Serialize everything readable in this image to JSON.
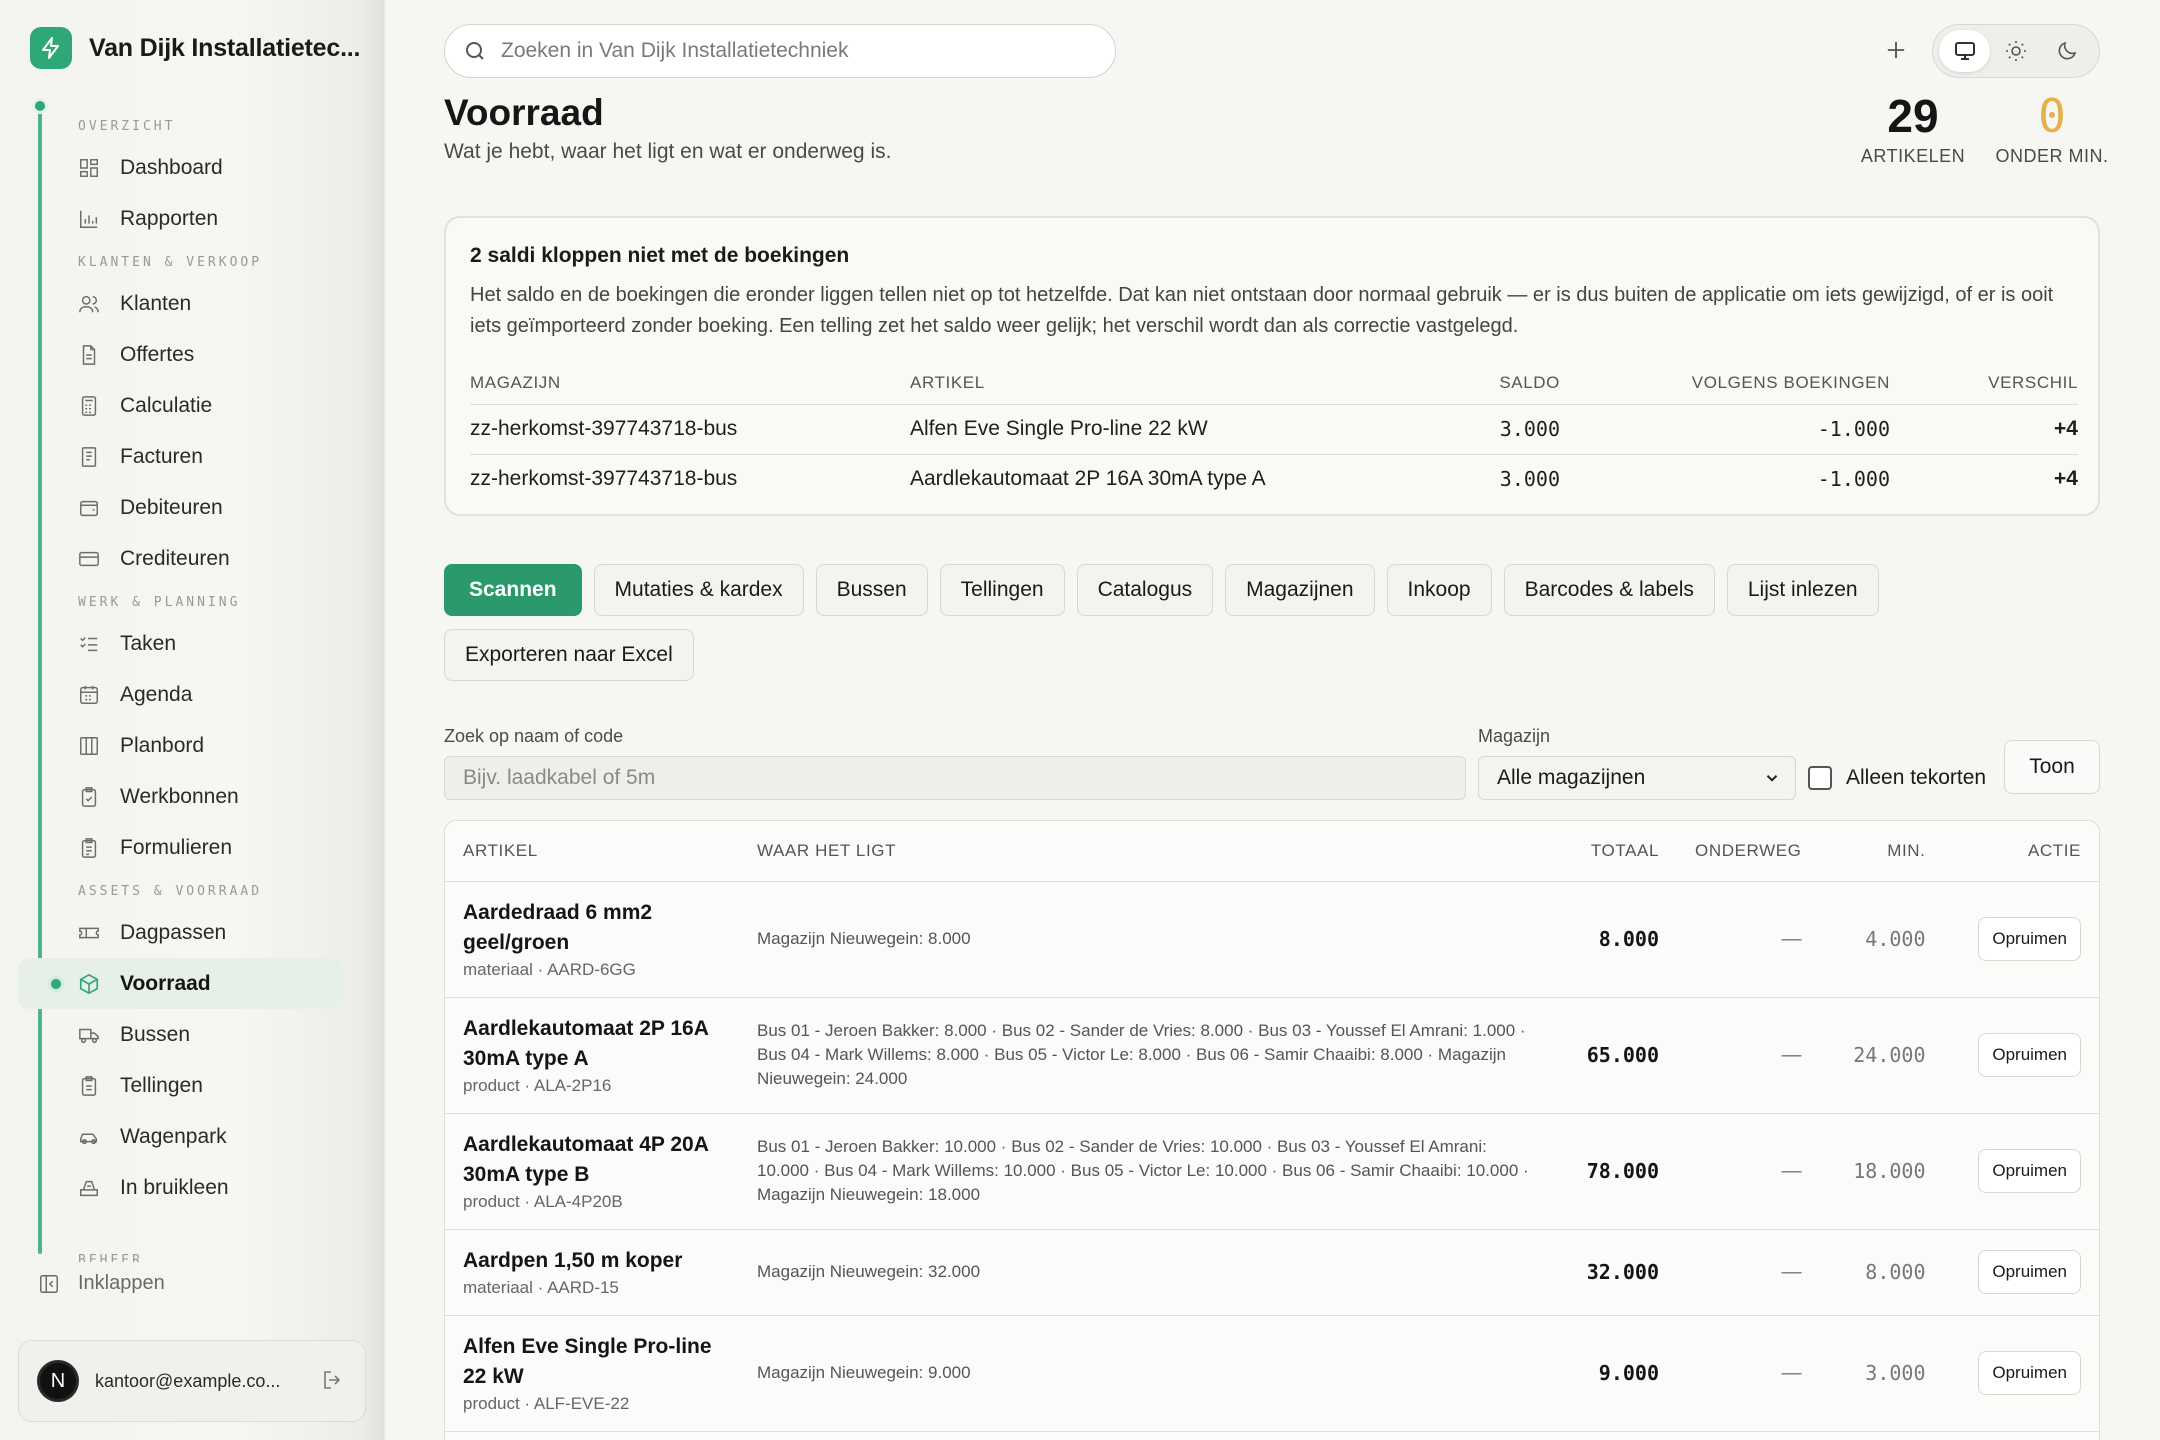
{
  "brand": {
    "name": "Van Dijk Installatietec..."
  },
  "nav": {
    "sections": [
      {
        "title": "OVERZICHT",
        "items": [
          {
            "label": "Dashboard",
            "icon": "dashboard-icon"
          },
          {
            "label": "Rapporten",
            "icon": "bar-chart-icon"
          }
        ]
      },
      {
        "title": "KLANTEN & VERKOOP",
        "items": [
          {
            "label": "Klanten",
            "icon": "users-icon"
          },
          {
            "label": "Offertes",
            "icon": "document-icon"
          },
          {
            "label": "Calculatie",
            "icon": "calculator-icon"
          },
          {
            "label": "Facturen",
            "icon": "invoice-icon"
          },
          {
            "label": "Debiteuren",
            "icon": "wallet-icon"
          },
          {
            "label": "Crediteuren",
            "icon": "card-icon"
          }
        ]
      },
      {
        "title": "WERK & PLANNING",
        "items": [
          {
            "label": "Taken",
            "icon": "list-icon"
          },
          {
            "label": "Agenda",
            "icon": "calendar-icon"
          },
          {
            "label": "Planbord",
            "icon": "board-icon"
          },
          {
            "label": "Werkbonnen",
            "icon": "clipboard-check-icon"
          },
          {
            "label": "Formulieren",
            "icon": "form-icon"
          }
        ]
      },
      {
        "title": "ASSETS & VOORRAAD",
        "items": [
          {
            "label": "Dagpassen",
            "icon": "ticket-icon"
          },
          {
            "label": "Voorraad",
            "icon": "box-icon",
            "active": true
          },
          {
            "label": "Bussen",
            "icon": "van-icon"
          },
          {
            "label": "Tellingen",
            "icon": "clipboard-icon"
          },
          {
            "label": "Wagenpark",
            "icon": "car-icon"
          },
          {
            "label": "In bruikleen",
            "icon": "tray-icon"
          }
        ]
      }
    ],
    "cut_section": "BEHEER",
    "collapse_label": "Inklappen"
  },
  "user": {
    "initial": "N",
    "email": "kantoor@example.co..."
  },
  "search": {
    "placeholder": "Zoeken in Van Dijk Installatietechniek"
  },
  "page": {
    "title": "Voorraad",
    "subtitle": "Wat je hebt, waar het ligt en wat er onderweg is."
  },
  "stats": {
    "articles": {
      "value": "29",
      "label": "ARTIKELEN"
    },
    "below_min": {
      "value": "0",
      "label": "ONDER MIN."
    }
  },
  "warning": {
    "title": "2 saldi kloppen niet met de boekingen",
    "text": "Het saldo en de boekingen die eronder liggen tellen niet op tot hetzelfde. Dat kan niet ontstaan door normaal gebruik — er is dus buiten de applicatie om iets gewijzigd, of er is ooit iets geïmporteerd zonder boeking. Een telling zet het saldo weer gelijk; het verschil wordt dan als correctie vastgelegd.",
    "columns": [
      "MAGAZIJN",
      "ARTIKEL",
      "SALDO",
      "VOLGENS BOEKINGEN",
      "VERSCHIL"
    ],
    "rows": [
      {
        "warehouse": "zz-herkomst-397743718-bus",
        "article": "Alfen Eve Single Pro-line 22 kW",
        "balance": "3.000",
        "by_bookings": "-1.000",
        "diff": "+4"
      },
      {
        "warehouse": "zz-herkomst-397743718-bus",
        "article": "Aardlekautomaat 2P 16A 30mA type A",
        "balance": "3.000",
        "by_bookings": "-1.000",
        "diff": "+4"
      }
    ]
  },
  "tabs": [
    {
      "label": "Scannen",
      "active": true
    },
    {
      "label": "Mutaties & kardex"
    },
    {
      "label": "Bussen"
    },
    {
      "label": "Tellingen"
    },
    {
      "label": "Catalogus"
    },
    {
      "label": "Magazijnen"
    },
    {
      "label": "Inkoop"
    },
    {
      "label": "Barcodes & labels"
    },
    {
      "label": "Lijst inlezen"
    },
    {
      "label": "Exporteren naar Excel"
    }
  ],
  "filter": {
    "search_label": "Zoek op naam of code",
    "search_placeholder": "Bijv. laadkabel of 5m",
    "warehouse_label": "Magazijn",
    "warehouse_selected": "Alle magazijnen",
    "shortage_label": "Alleen tekorten",
    "show_button": "Toon"
  },
  "table": {
    "columns": [
      "ARTIKEL",
      "WAAR HET LIGT",
      "TOTAAL",
      "ONDERWEG",
      "MIN.",
      "ACTIE"
    ],
    "rows": [
      {
        "name": "Aardedraad 6 mm2 geel/groen",
        "meta": "materiaal · AARD-6GG",
        "where": "Magazijn Nieuwegein: 8.000",
        "total": "8.000",
        "transit": "—",
        "min": "4.000",
        "action": "Opruimen"
      },
      {
        "name": "Aardlekautomaat 2P 16A 30mA type A",
        "meta": "product · ALA-2P16",
        "where": "Bus 01 - Jeroen Bakker: 8.000 · Bus 02 - Sander de Vries: 8.000 · Bus 03 - Youssef El Amrani: 1.000 · Bus 04 - Mark Willems: 8.000 · Bus 05 - Victor Le: 8.000 · Bus 06 - Samir Chaaibi: 8.000 · Magazijn Nieuwegein: 24.000",
        "total": "65.000",
        "transit": "—",
        "min": "24.000",
        "action": "Opruimen"
      },
      {
        "name": "Aardlekautomaat 4P 20A 30mA type B",
        "meta": "product · ALA-4P20B",
        "where": "Bus 01 - Jeroen Bakker: 10.000 · Bus 02 - Sander de Vries: 10.000 · Bus 03 - Youssef El Amrani: 10.000 · Bus 04 - Mark Willems: 10.000 · Bus 05 - Victor Le: 10.000 · Bus 06 - Samir Chaaibi: 10.000 · Magazijn Nieuwegein: 18.000",
        "total": "78.000",
        "transit": "—",
        "min": "18.000",
        "action": "Opruimen"
      },
      {
        "name": "Aardpen 1,50 m koper",
        "meta": "materiaal · AARD-15",
        "where": "Magazijn Nieuwegein: 32.000",
        "total": "32.000",
        "transit": "—",
        "min": "8.000",
        "action": "Opruimen"
      },
      {
        "name": "Alfen Eve Single Pro-line 22 kW",
        "meta": "product · ALF-EVE-22",
        "where": "Magazijn Nieuwegein: 9.000",
        "total": "9.000",
        "transit": "—",
        "min": "3.000",
        "action": "Opruimen"
      }
    ]
  },
  "colors": {
    "accent": "#2fa877",
    "tab_active": "#2a9a6d",
    "warn": "#e6b14a"
  }
}
